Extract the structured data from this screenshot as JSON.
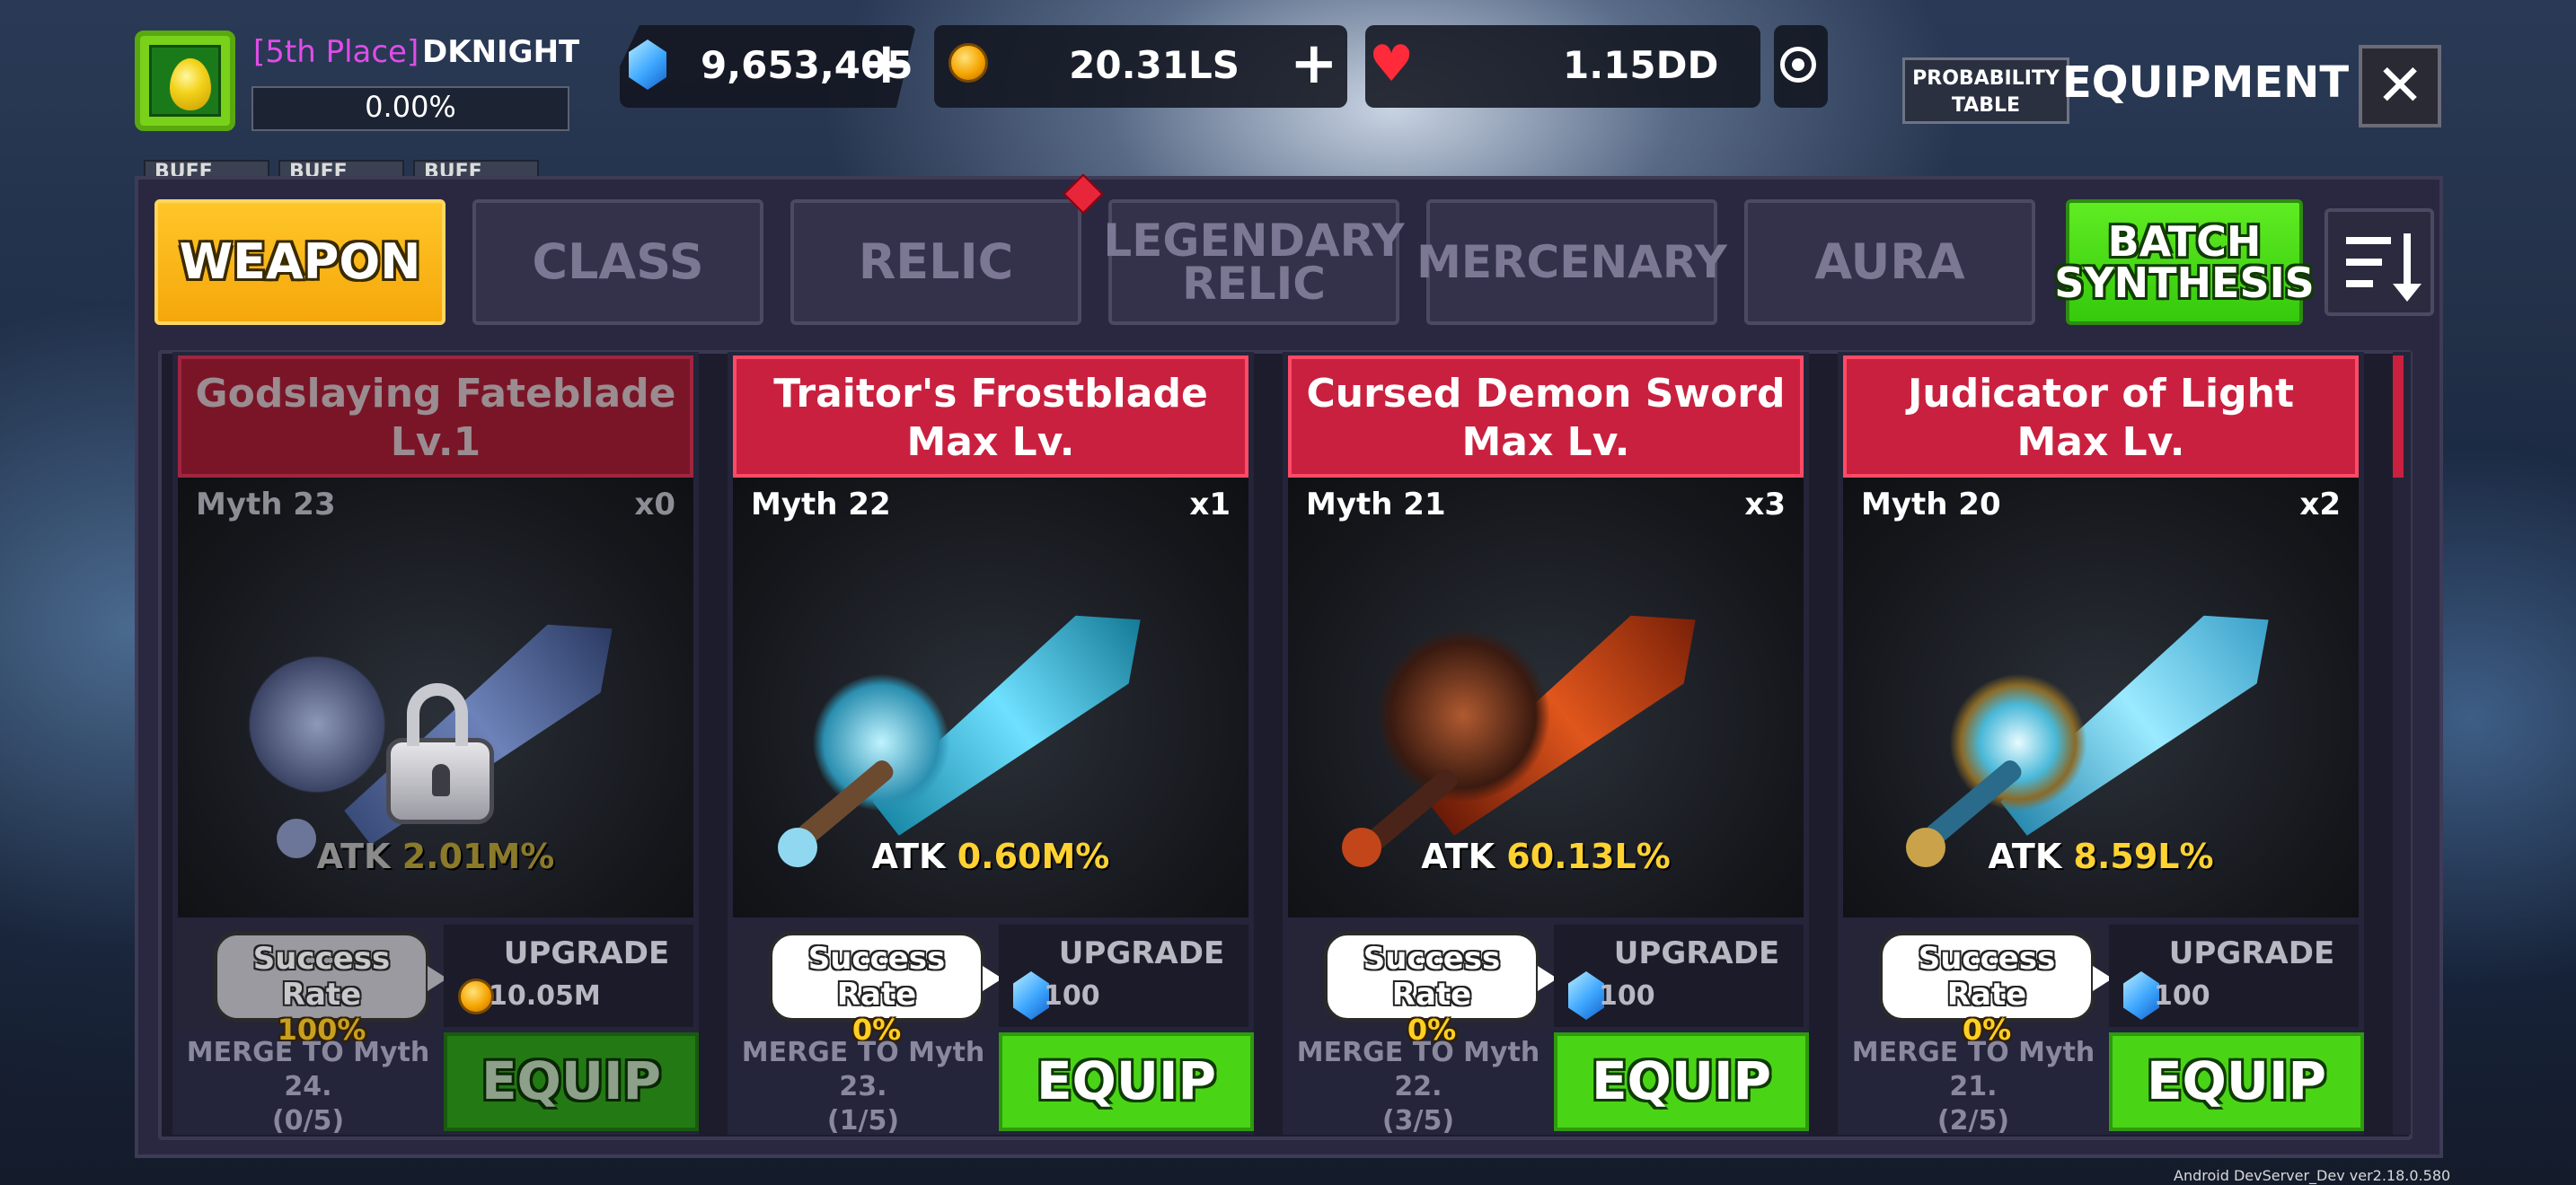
{
  "player": {
    "place": "[5th Place]",
    "name": "DKNIGHT",
    "progress_text": "0.00%",
    "avatar_icon": "golden-egg-icon"
  },
  "resources": {
    "gems": "9,653,405",
    "gold": "20.31LS",
    "hp": "1.15DD",
    "plus": "+"
  },
  "header": {
    "probability_table": "PROBABILITY TABLE",
    "title": "EQUIPMENT",
    "close": "✕"
  },
  "buffs": [
    "BUFF",
    "BUFF",
    "BUFF"
  ],
  "tabs": [
    {
      "label": "WEAPON",
      "active": true
    },
    {
      "label": "CLASS",
      "active": false
    },
    {
      "label": "RELIC",
      "active": false
    },
    {
      "label": "LEGENDARY RELIC",
      "active": false
    },
    {
      "label": "MERCENARY",
      "active": false
    },
    {
      "label": "AURA",
      "active": false
    }
  ],
  "batch_synthesis": "BATCH SYNTHESIS",
  "cards": [
    {
      "name": "Godslaying Fateblade",
      "level": "Lv.1",
      "grade": "Myth 23",
      "count": "x0",
      "atk_label": "ATK",
      "atk_value": "2.01M%",
      "rate_label": "Success Rate",
      "rate_value": "100%",
      "upgrade_label": "UPGRADE",
      "upgrade_cost": "10.05M",
      "cost_icon": "gold-coin-icon",
      "merge": "MERGE TO Myth 24.",
      "merge_progress": "(0/5)",
      "equip": "EQUIP",
      "locked": true
    },
    {
      "name": "Traitor's Frostblade",
      "level": "Max Lv.",
      "grade": "Myth 22",
      "count": "x1",
      "atk_label": "ATK",
      "atk_value": "0.60M%",
      "rate_label": "Success Rate",
      "rate_value": "0%",
      "upgrade_label": "UPGRADE",
      "upgrade_cost": "100",
      "cost_icon": "gem-icon",
      "merge": "MERGE TO Myth 23.",
      "merge_progress": "(1/5)",
      "equip": "EQUIP",
      "locked": false
    },
    {
      "name": "Cursed Demon Sword",
      "level": "Max Lv.",
      "grade": "Myth 21",
      "count": "x3",
      "atk_label": "ATK",
      "atk_value": "60.13L%",
      "rate_label": "Success Rate",
      "rate_value": "0%",
      "upgrade_label": "UPGRADE",
      "upgrade_cost": "100",
      "cost_icon": "gem-icon",
      "merge": "MERGE TO Myth 22.",
      "merge_progress": "(3/5)",
      "equip": "EQUIP",
      "locked": false
    },
    {
      "name": "Judicator of Light",
      "level": "Max Lv.",
      "grade": "Myth 20",
      "count": "x2",
      "atk_label": "ATK",
      "atk_value": "8.59L%",
      "rate_label": "Success Rate",
      "rate_value": "0%",
      "upgrade_label": "UPGRADE",
      "upgrade_cost": "100",
      "cost_icon": "gem-icon",
      "merge": "MERGE TO Myth 21.",
      "merge_progress": "(2/5)",
      "equip": "EQUIP",
      "locked": false
    }
  ],
  "build": "Android DevServer_Dev ver2.18.0.580",
  "colors": {
    "active_tab": "#f5a70a",
    "batch_button": "#35c90d",
    "equip_button": "#4ad416",
    "card_header": "#c9203f",
    "atk_value": "#ffd232",
    "rank_label": "#e04ce8"
  }
}
